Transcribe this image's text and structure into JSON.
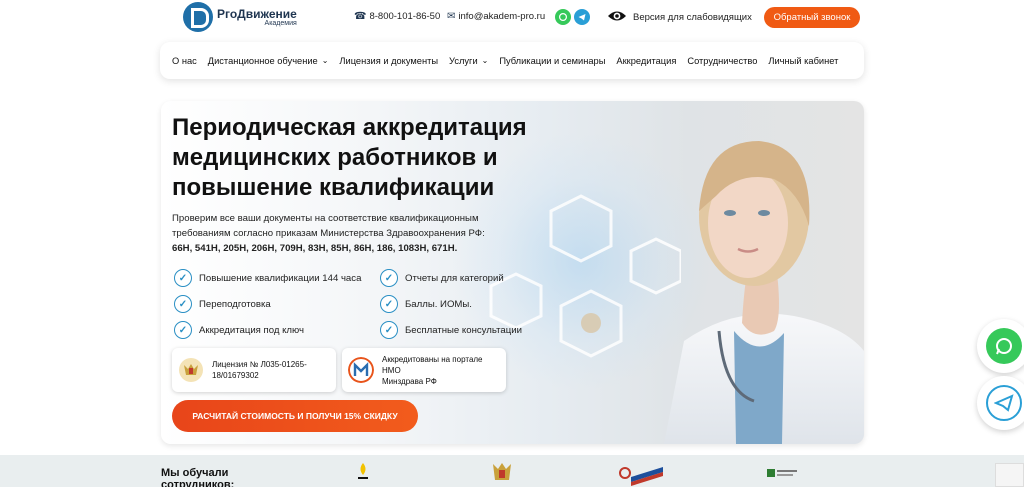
{
  "header": {
    "logo_title": "PгоДвижение",
    "logo_sub": "Академия",
    "phone": "8-800-101-86-50",
    "email": "info@akadem-pro.ru",
    "accessibility_label": "Версия для слабовидящих",
    "callback_label": "Обратный звонок"
  },
  "nav": {
    "items": [
      {
        "label": "О нас"
      },
      {
        "label": "Дистанционное обучение"
      },
      {
        "label": "Лицензия и документы"
      },
      {
        "label": "Услуги"
      },
      {
        "label": "Публикации и семинары"
      },
      {
        "label": "Аккредитация"
      },
      {
        "label": "Сотрудничество"
      },
      {
        "label": "Личный кабинет"
      }
    ]
  },
  "hero": {
    "title_line1": "Периодическая аккредитация",
    "title_line2": "медицинских работников и",
    "title_line3": "повышение квалификации",
    "desc_line1": "Проверим все ваши документы на соответствие квалификационным",
    "desc_line2": "требованиям согласно приказам Министерства Здравоохранения РФ:",
    "desc_orders": "66Н, 541Н, 205Н, 206Н, 709Н, 83Н, 85Н, 86Н, 186, 1083Н, 671Н.",
    "features_left": [
      "Повышение квалификации 144 часа",
      "Переподготовка",
      "Аккредитация под ключ"
    ],
    "features_right": [
      "Отчеты для категорий",
      "Баллы. ИОМы.",
      "Бесплатные консультации"
    ],
    "license_line1": "Лицензия № Л035-01265-",
    "license_line2": "18/01679302",
    "nmo_line1": "Аккредитованы на портале НМО",
    "nmo_line2": "Минздрава РФ",
    "cta_label": "РАСЧИТАЙ СТОИМОСТЬ И ПОЛУЧИ 15% СКИДКУ"
  },
  "bottom": {
    "trained_line1": "Мы обучали",
    "trained_line2": "сотрудников:"
  },
  "colors": {
    "accent": "#f05a13",
    "brand": "#1f3550",
    "check": "#2a8fc4",
    "whatsapp": "#36c95a",
    "telegram": "#2a9fd6"
  }
}
